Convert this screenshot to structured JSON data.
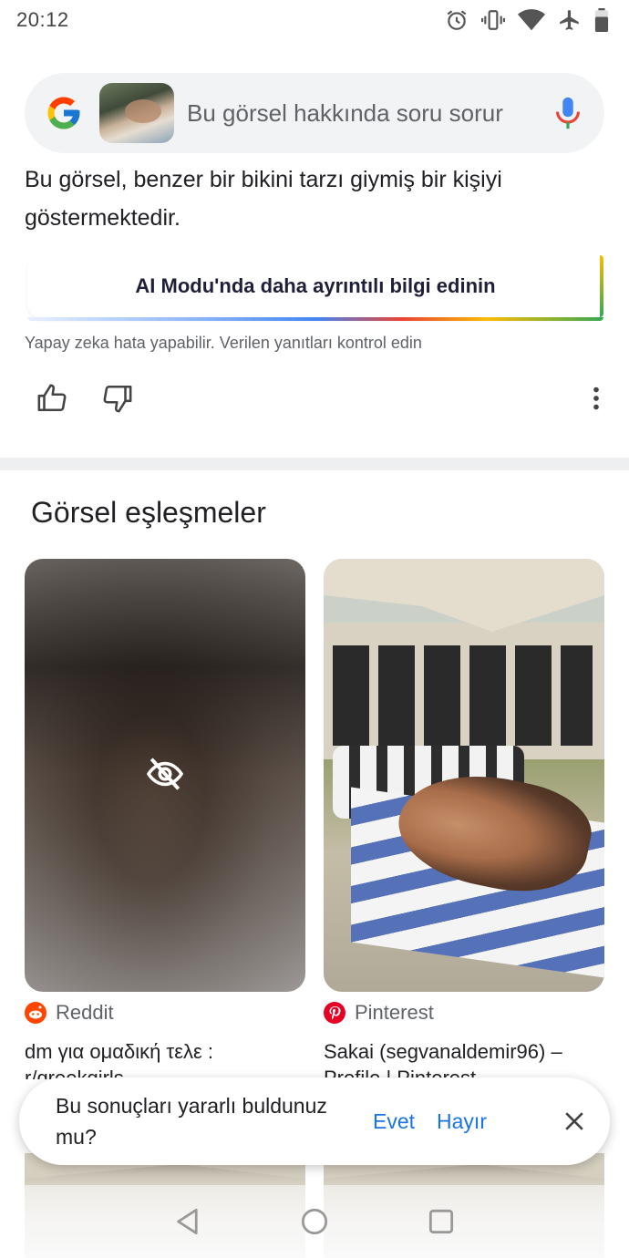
{
  "status_bar": {
    "time": "20:12",
    "icons": [
      "alarm-icon",
      "vibrate-icon",
      "wifi-icon",
      "airplane-icon",
      "battery-icon"
    ]
  },
  "search": {
    "placeholder": "Bu görsel hakkında soru sorur",
    "logo": "google-g-logo",
    "mic_icon": "mic-icon"
  },
  "answer": {
    "text": "Bu görsel, benzer bir bikini tarzı giymiş bir kişiyi göstermektedir."
  },
  "ai_mode_button": {
    "label": "AI Modu'nda daha ayrıntılı bilgi edinin"
  },
  "disclaimer": "Yapay zeka hata yapabilir. Verilen yanıtları kontrol edin",
  "section": {
    "title": "Görsel eşleşmeler"
  },
  "results": [
    {
      "source": "Reddit",
      "title": "dm για ομαδική τελε :",
      "subtitle": "r/greekgirls"
    },
    {
      "source": "Pinterest",
      "title": "Sakai (segvanaldemir96) –",
      "subtitle": "Profile | Pinterest"
    }
  ],
  "toast": {
    "question": "Bu sonuçları yararlı buldunuz mu?",
    "yes": "Evet",
    "no": "Hayır"
  },
  "colors": {
    "link_blue": "#1a73e8",
    "reddit_orange": "#ff4500",
    "pinterest_red": "#e60023"
  }
}
